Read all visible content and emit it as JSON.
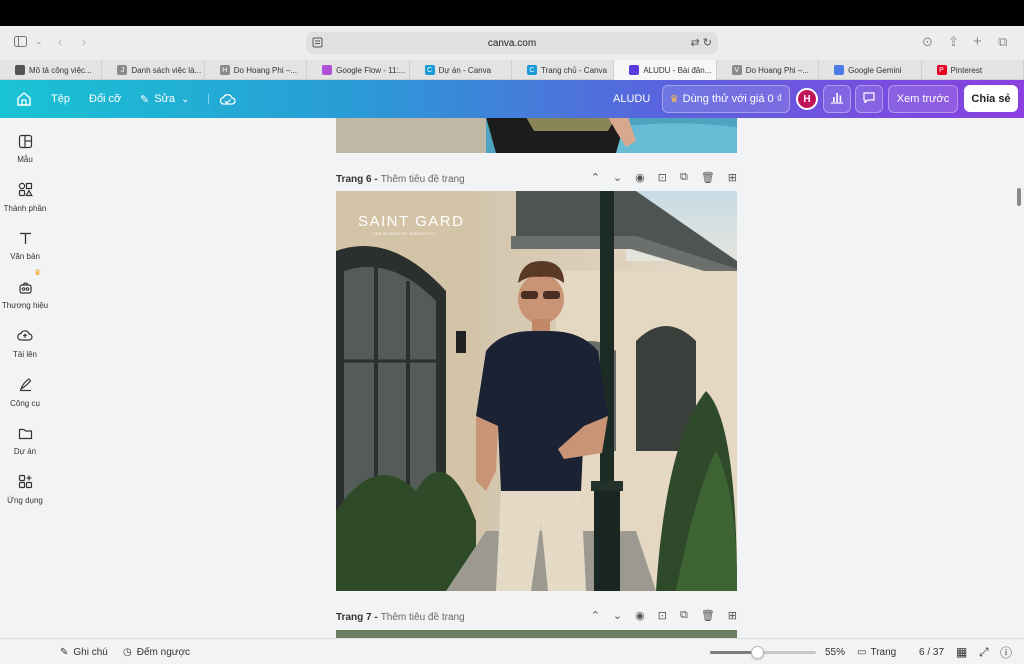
{
  "browser": {
    "url": "canva.com",
    "tabs": [
      {
        "label": "Mô tả công việc...",
        "fav": "gear",
        "color": "#555"
      },
      {
        "label": "Danh sách việc là...",
        "fav": "J",
        "color": "#8a8a8a"
      },
      {
        "label": "Do Hoang Phi –...",
        "fav": "H",
        "color": "#8a8a8a"
      },
      {
        "label": "Google Flow - 11:...",
        "fav": "flow",
        "color": "#b050d8"
      },
      {
        "label": "Dự án - Canva",
        "fav": "C",
        "color": "#1a9bd6"
      },
      {
        "label": "Trang chủ - Canva",
        "fav": "C",
        "color": "#1a9bd6"
      },
      {
        "label": "ALUDU - Bài đăn...",
        "fav": "heart",
        "color": "#5a3be0"
      },
      {
        "label": "Do Hoang Phi –...",
        "fav": "V",
        "color": "#8a8a8a"
      },
      {
        "label": "Google Gemini",
        "fav": "gemini",
        "color": "#4a7be8"
      },
      {
        "label": "Pinterest",
        "fav": "P",
        "color": "#e60023"
      }
    ]
  },
  "header": {
    "file_label": "Tệp",
    "resize_label": "Đổi cỡ",
    "edit_label": "Sửa",
    "doc_title": "ALUDU",
    "trial_label": "Dùng thử với giá 0 ₫",
    "avatar_letter": "H",
    "preview_label": "Xem trước",
    "share_label": "Chia sẻ"
  },
  "sidebar": {
    "items": [
      {
        "label": "Mẫu",
        "icon": "template-icon"
      },
      {
        "label": "Thành phần",
        "icon": "elements-icon"
      },
      {
        "label": "Văn bản",
        "icon": "text-icon"
      },
      {
        "label": "Thương hiệu",
        "icon": "brand-icon"
      },
      {
        "label": "Tải lên",
        "icon": "upload-icon"
      },
      {
        "label": "Công cụ",
        "icon": "tools-icon"
      },
      {
        "label": "Dự án",
        "icon": "folder-icon"
      },
      {
        "label": "Ứng dụng",
        "icon": "apps-icon"
      }
    ]
  },
  "pages": {
    "page6": {
      "title": "Trang 6 -",
      "subtitle": "Thêm tiêu đề trang"
    },
    "page7": {
      "title": "Trang 7 -",
      "subtitle": "Thêm tiêu đề trang"
    }
  },
  "design": {
    "brand": "SAINT GARD",
    "tagline": "THE POWER OF SIMPLICITY"
  },
  "bottombar": {
    "notes_label": "Ghi chú",
    "timer_label": "Đếm ngược",
    "zoom_value": 55,
    "zoom_label": "55%",
    "pages_label": "Trang",
    "page_indicator": "6 / 37"
  },
  "colors": {
    "header_gradient_start": "#19c3d4",
    "header_gradient_end": "#8b3fe0",
    "avatar": "#c1155a"
  }
}
